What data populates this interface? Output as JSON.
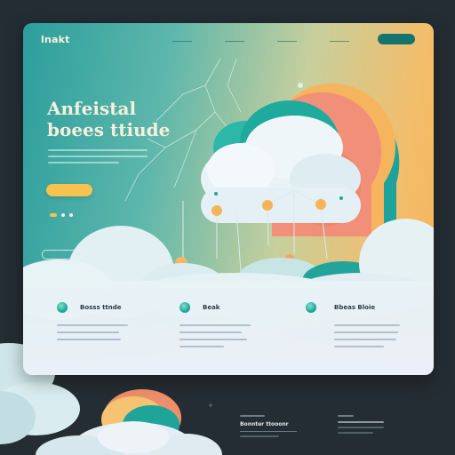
{
  "header": {
    "logo": "lnakt",
    "nav": [
      "",
      "",
      "",
      ""
    ],
    "cta": ""
  },
  "hero": {
    "headline_line1": "Anfeistal",
    "headline_line2": "boees ttiude",
    "primary_button": "",
    "secondary_button": ""
  },
  "features": [
    {
      "title": "Bosss ttnde",
      "icon": "circle-icon"
    },
    {
      "title": "Beak",
      "icon": "circle-icon"
    },
    {
      "title": "Bbeas Bloie",
      "icon": "circle-icon"
    }
  ],
  "footer": {
    "card1_title": "Bonnter ttooonr",
    "card2_title": ""
  },
  "colors": {
    "teal": "#2c9e9c",
    "orange": "#f3bd6b",
    "accent_yellow": "#f7c24d",
    "dark_bg": "#242d34",
    "cloud_coral": "#f18f78"
  }
}
